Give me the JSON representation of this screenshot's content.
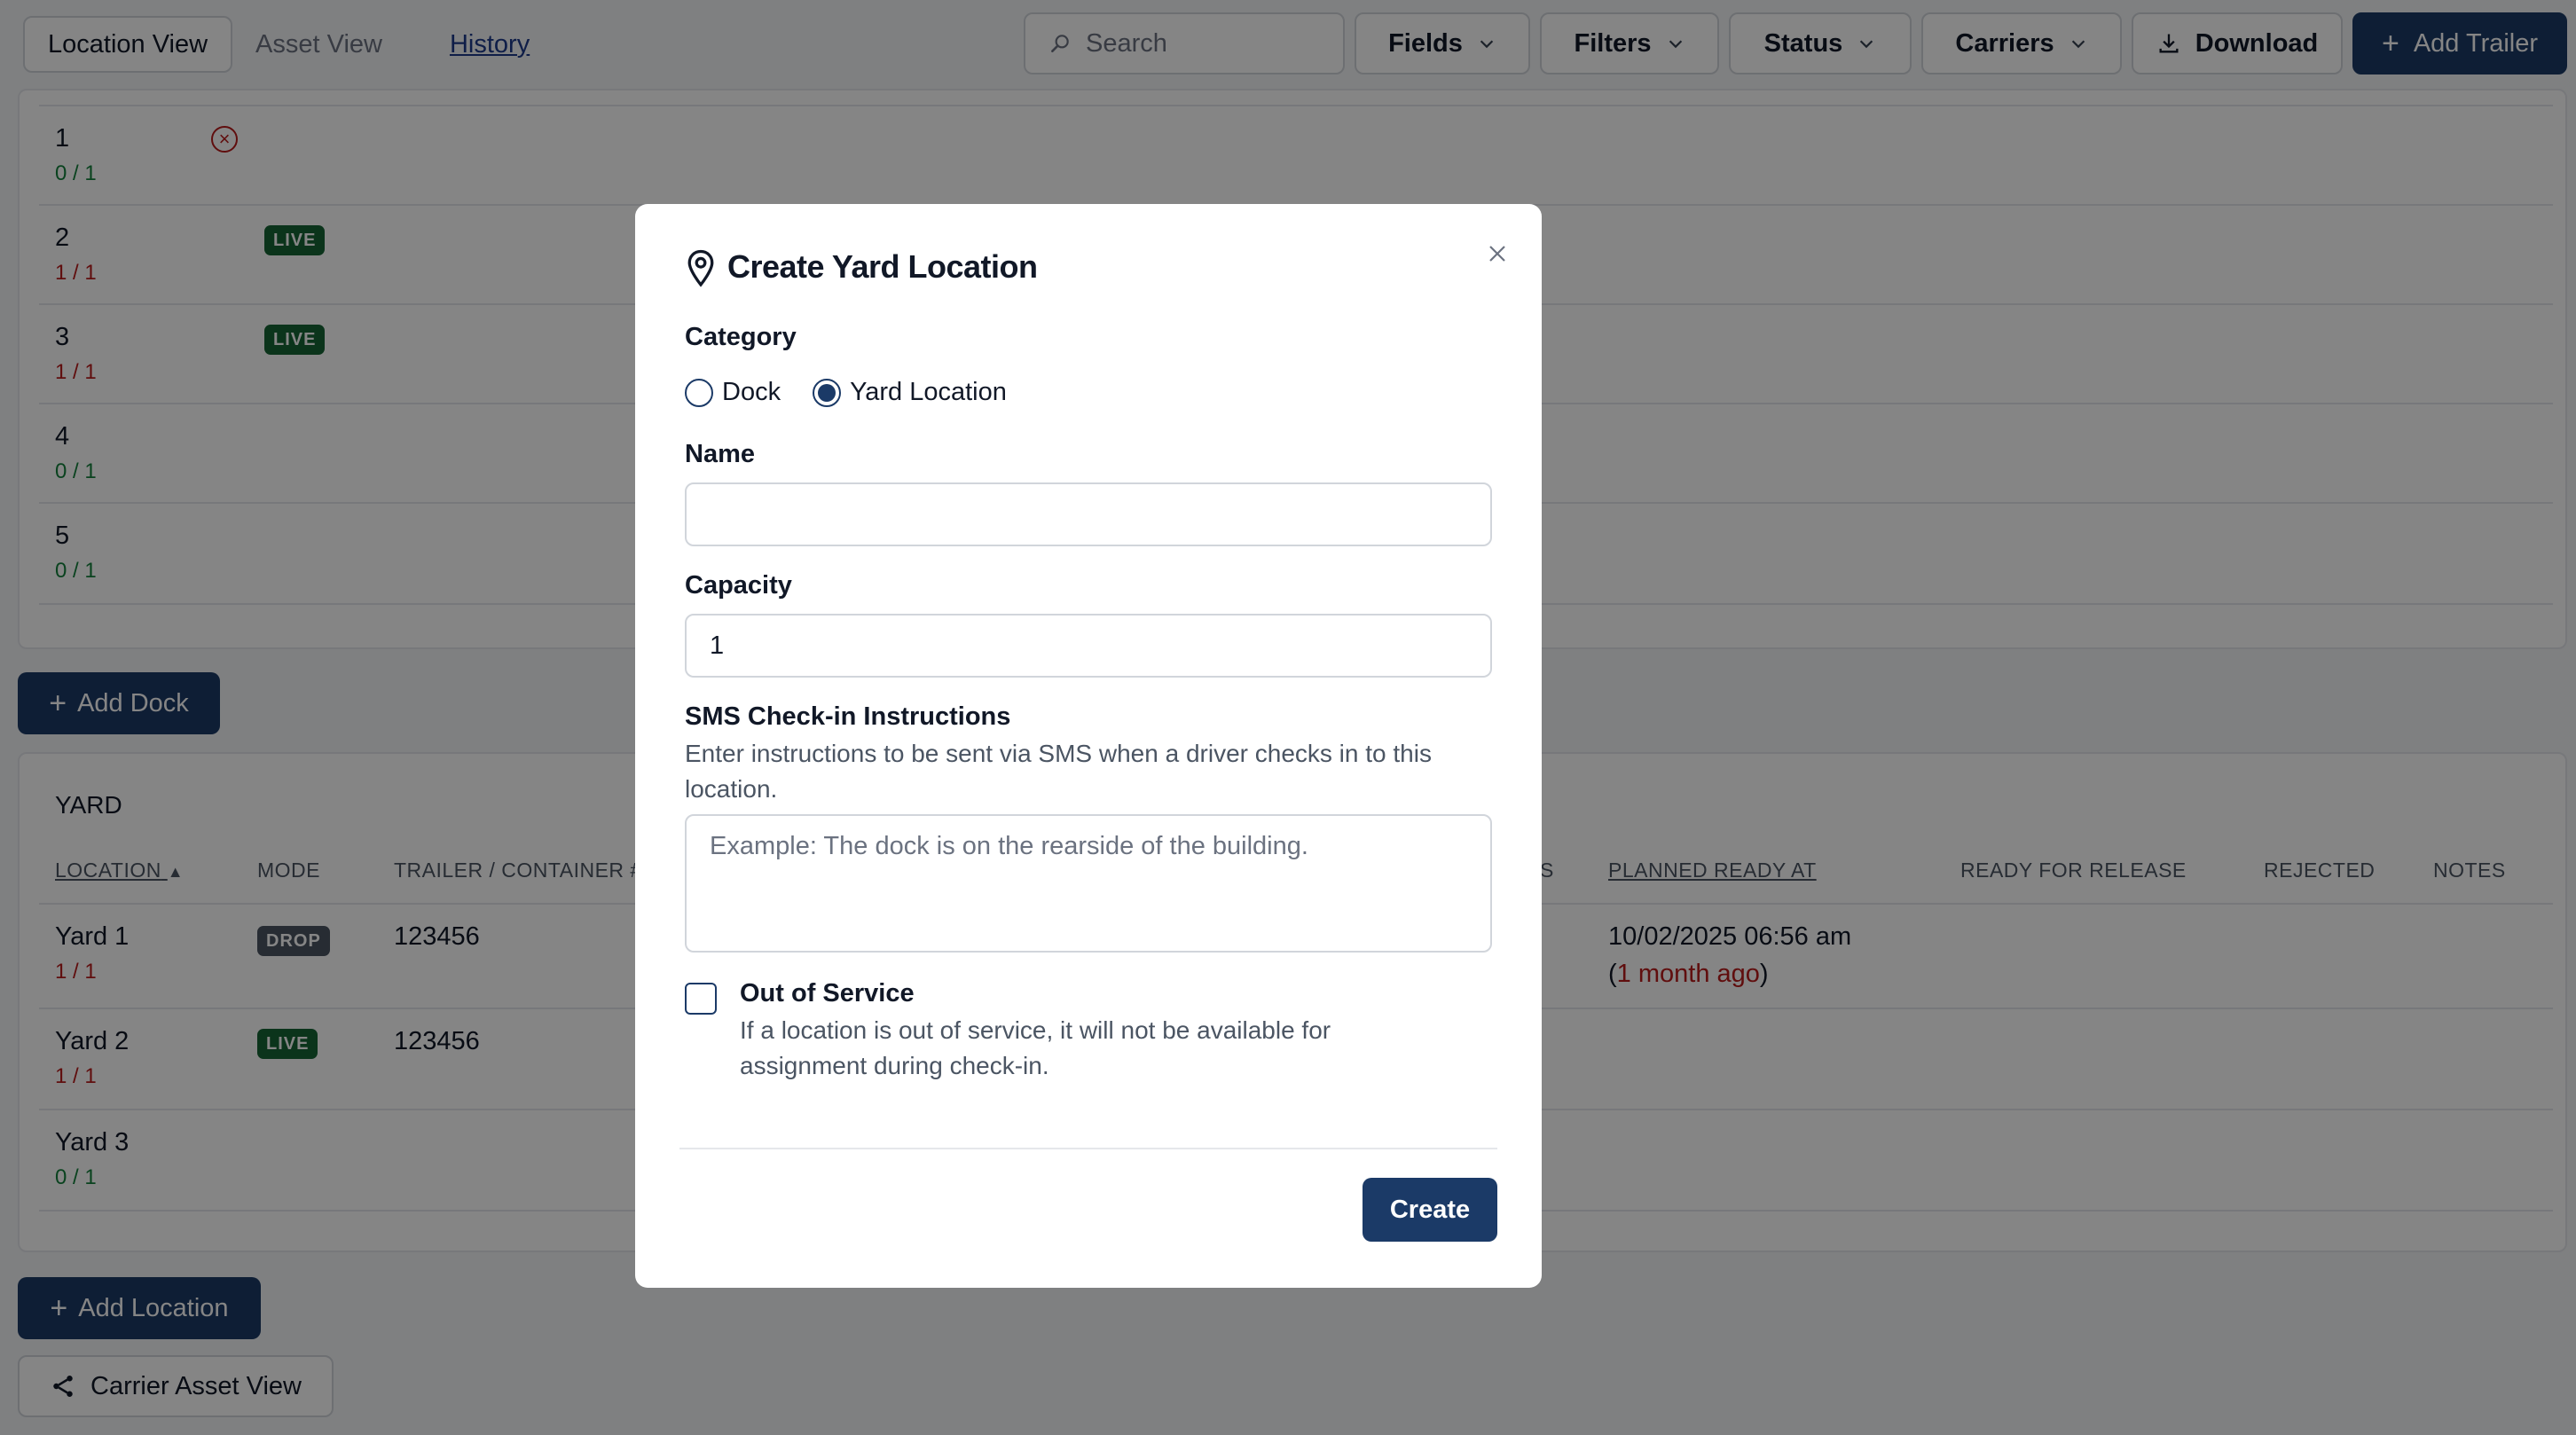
{
  "topbar": {
    "tabs": [
      {
        "label": "Location View"
      },
      {
        "label": "Asset View"
      },
      {
        "label": "History"
      }
    ],
    "search_placeholder": "Search",
    "fields_label": "Fields",
    "filters_label": "Filters",
    "status_label": "Status",
    "carriers_label": "Carriers",
    "download_label": "Download",
    "add_trailer_label": "Add Trailer"
  },
  "docks": [
    {
      "name": "1",
      "capacity": "0 / 1",
      "cap_state": "green",
      "mode": ""
    },
    {
      "name": "2",
      "capacity": "1 / 1",
      "cap_state": "red",
      "mode": "LIVE"
    },
    {
      "name": "3",
      "capacity": "1 / 1",
      "cap_state": "red",
      "mode": "LIVE"
    },
    {
      "name": "4",
      "capacity": "0 / 1",
      "cap_state": "green",
      "mode": ""
    },
    {
      "name": "5",
      "capacity": "0 / 1",
      "cap_state": "green",
      "mode": ""
    }
  ],
  "add_dock_label": "Add Dock",
  "yard": {
    "section_title": "YARD",
    "headers": {
      "location": "LOCATION",
      "mode": "MODE",
      "trailer": "TRAILER / CONTAINER #",
      "s": "S",
      "planned_ready_at": "PLANNED READY AT",
      "ready_for_release": "READY FOR RELEASE",
      "rejected": "REJECTED",
      "notes": "NOTES"
    },
    "rows": [
      {
        "name": "Yard 1",
        "capacity": "1 / 1",
        "mode": "DROP",
        "trailer": "123456",
        "planned": "10/02/2025 06:56 am",
        "planned_open": "(",
        "planned_rel": "1 month ago",
        "planned_close": ")"
      },
      {
        "name": "Yard 2",
        "capacity": "1 / 1",
        "mode": "LIVE",
        "trailer": "123456",
        "planned": "",
        "planned_open": "",
        "planned_rel": "",
        "planned_close": ""
      },
      {
        "name": "Yard 3",
        "capacity": "0 / 1",
        "mode": "",
        "trailer": "",
        "planned": "",
        "planned_open": "",
        "planned_rel": "",
        "planned_close": ""
      }
    ]
  },
  "add_location_label": "Add Location",
  "carrier_asset_view_label": "Carrier Asset View",
  "modal": {
    "title": "Create Yard Location",
    "category_label": "Category",
    "category_options": [
      "Dock",
      "Yard Location"
    ],
    "category_selected": "Yard Location",
    "name_label": "Name",
    "name_value": "",
    "capacity_label": "Capacity",
    "capacity_value": "1",
    "sms_label": "SMS Check-in Instructions",
    "sms_help": "Enter instructions to be sent via SMS when a driver checks in to this location.",
    "sms_placeholder": "Example: The dock is on the rearside of the building.",
    "oos_label": "Out of Service",
    "oos_help": "If a location is out of service, it will not be available for assignment during check-in.",
    "oos_checked": false,
    "create_label": "Create"
  },
  "colors": {
    "primary": "#1b3a67",
    "live_badge": "#166534",
    "drop_badge": "#4b5563",
    "capacity_full": "#b91c1c",
    "capacity_available": "#15803d"
  },
  "icons": {
    "search": "search-icon",
    "chevron": "chevron-down-icon",
    "download": "download-icon",
    "plus": "plus-icon",
    "share": "share-icon",
    "pin": "map-pin-icon",
    "close": "close-icon",
    "error": "x-circle-icon",
    "sort": "sort-asc-icon"
  }
}
